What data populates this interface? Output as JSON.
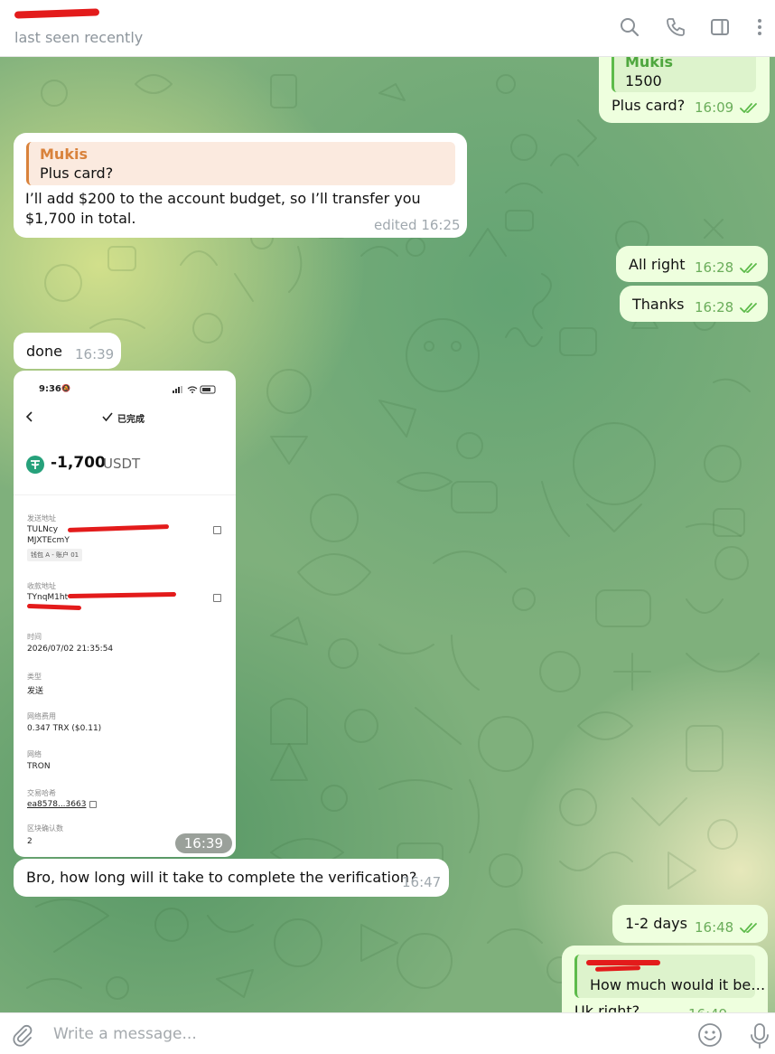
{
  "header": {
    "status": "last seen recently"
  },
  "messages": {
    "m1": {
      "reply_name": "Mukis",
      "reply_text": "1500",
      "text": "Plus card?",
      "time": "16:09"
    },
    "m2": {
      "reply_name": "Mukis",
      "reply_text": "Plus card?",
      "text": "I’ll add $200 to the account budget, so I’ll transfer you $1,700 in total.",
      "time": "edited 16:25"
    },
    "m3": {
      "text": "All right",
      "time": "16:28"
    },
    "m4": {
      "text": "Thanks",
      "time": "16:28"
    },
    "m5": {
      "text": "done",
      "time": "16:39"
    },
    "m6": {
      "time": "16:39"
    },
    "m7": {
      "text": "Bro, how long will it take to complete the verification?",
      "time": "16:47"
    },
    "m8": {
      "text": "1-2 days",
      "time": "16:48"
    },
    "m9": {
      "reply_text": "How much would it be…",
      "text": "Uk right?",
      "time": "16:49"
    }
  },
  "screenshot": {
    "status_time": "9:36",
    "status_mute": "🔕",
    "title": "已完成",
    "amount": "-1,700",
    "currency": "USDT",
    "from_label": "发送地址",
    "from_line1": "TULNcy",
    "from_line2": "MJXTEcmY",
    "from_tag": "钱包 A - 账户 01",
    "to_label": "收款地址",
    "to_line1": "TYnqM1ht",
    "time_label": "时间",
    "time_value": "2026/07/02 21:35:54",
    "type_label": "类型",
    "type_value": "发送",
    "fee_label": "网络费用",
    "fee_value": "0.347 TRX ($0.11)",
    "network_label": "网络",
    "network_value": "TRON",
    "hash_label": "交易哈希",
    "hash_value": "ea8578...3663",
    "confirm_label": "区块确认数",
    "confirm_value": "2"
  },
  "input": {
    "placeholder": "Write a message..."
  },
  "colors": {
    "outgoing_bubble": "#eeffde",
    "incoming_bubble": "#ffffff",
    "accent_green": "#5dbb4a",
    "accent_orange": "#d9823b",
    "redaction": "#e31b1b"
  },
  "icons": [
    "search-icon",
    "phone-icon",
    "sidebar-icon",
    "more-icon",
    "attach-icon",
    "emoji-icon",
    "mic-icon",
    "double-check-icon",
    "tether-icon",
    "copy-icon",
    "back-icon"
  ]
}
